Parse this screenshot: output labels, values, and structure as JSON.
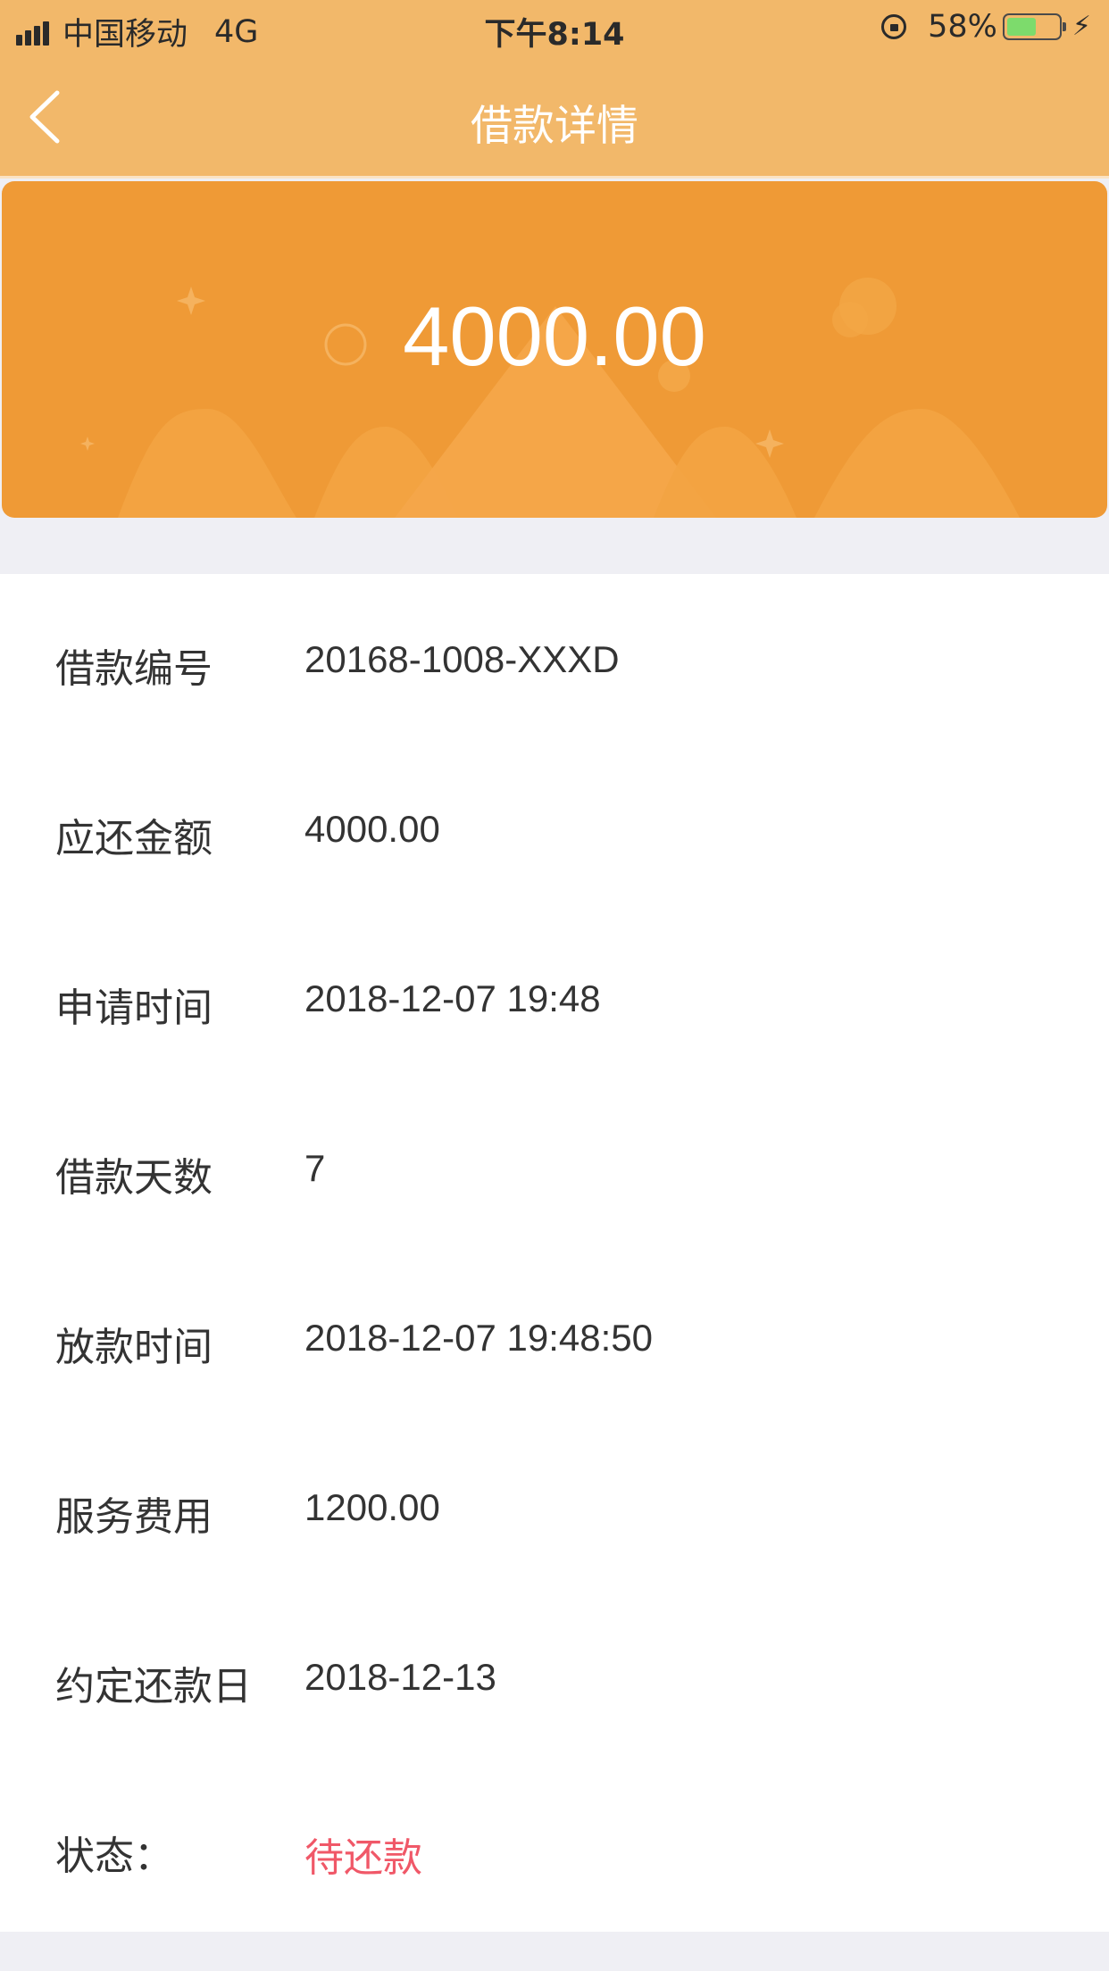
{
  "status_bar": {
    "carrier": "中国移动",
    "network": "4G",
    "time": "下午8:14",
    "battery_percent_text": "58%",
    "battery_level": 0.58,
    "battery_color": "#7ddb6c"
  },
  "nav": {
    "title": "借款详情",
    "back_icon": "chevron-left-icon"
  },
  "banner": {
    "amount": "4000.00",
    "color": "#ef9a36"
  },
  "details": [
    {
      "label": "借款编号",
      "value": "20168-1008-XXXD"
    },
    {
      "label": "应还金额",
      "value": "4000.00"
    },
    {
      "label": "申请时间",
      "value": "2018-12-07 19:48"
    },
    {
      "label": "借款天数",
      "value": "7"
    },
    {
      "label": "放款时间",
      "value": "2018-12-07 19:48:50"
    },
    {
      "label": "服务费用",
      "value": "1200.00"
    },
    {
      "label": "约定还款日",
      "value": "2018-12-13"
    },
    {
      "label": "状态：",
      "value": "待还款"
    }
  ],
  "colors": {
    "header": "#f2b86a",
    "status_text": "#f05868"
  }
}
